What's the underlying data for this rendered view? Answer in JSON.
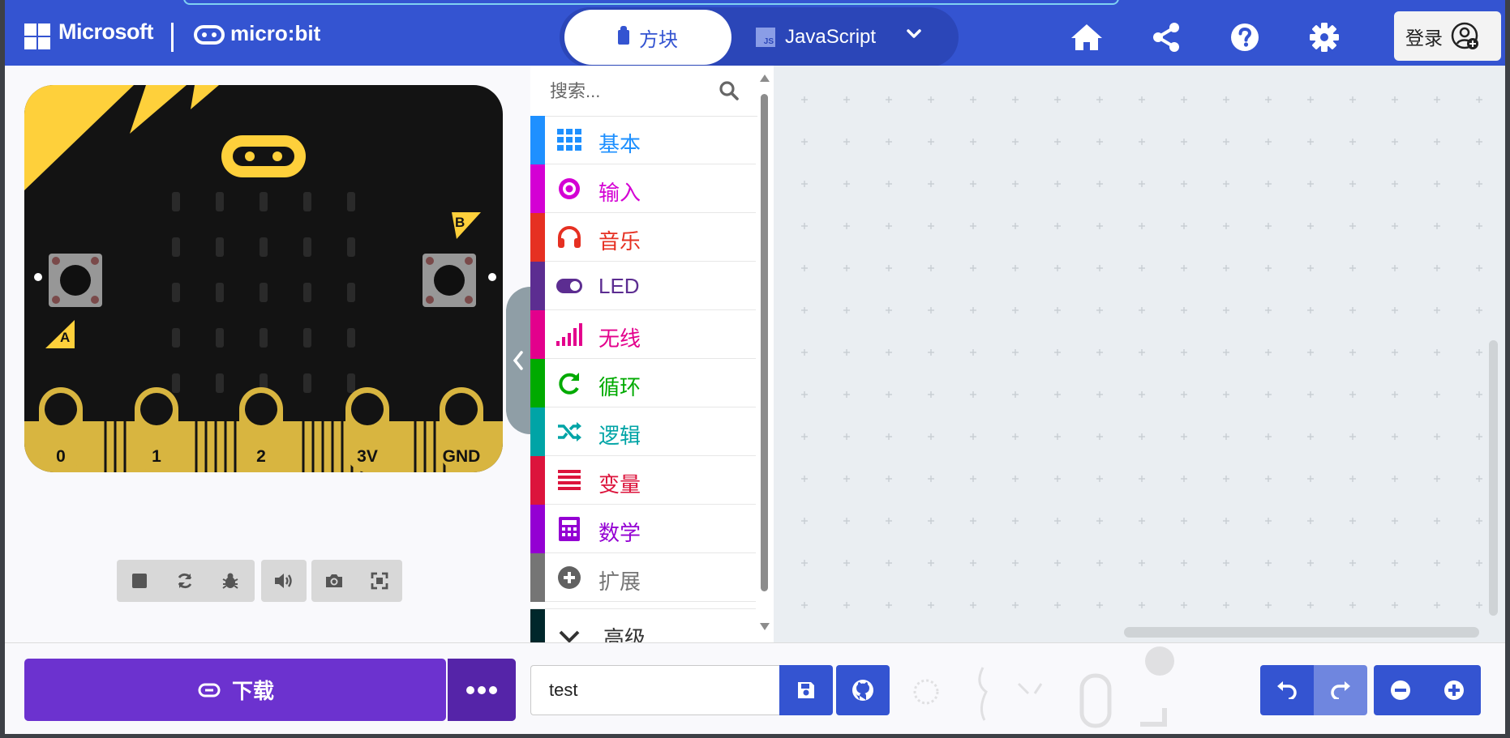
{
  "header": {
    "brand": "Microsoft",
    "product": "micro:bit",
    "tabs": [
      {
        "label": "方块",
        "active": true
      },
      {
        "label": "JavaScript",
        "active": false
      }
    ],
    "js_badge": "JS",
    "login_label": "登录",
    "icons": [
      "home-icon",
      "share-icon",
      "help-icon",
      "settings-icon",
      "user-add-icon"
    ]
  },
  "simulator": {
    "button_a": "A",
    "button_b": "B",
    "pins": [
      "0",
      "1",
      "2",
      "3V",
      "GND"
    ],
    "controls": [
      "stop-icon",
      "restart-icon",
      "debug-icon",
      "sound-icon",
      "screenshot-icon",
      "fullscreen-icon"
    ]
  },
  "toolbox": {
    "search_placeholder": "搜索...",
    "categories": [
      {
        "label": "基本",
        "color": "#1e90ff",
        "icon": "grid-icon"
      },
      {
        "label": "输入",
        "color": "#d400d4",
        "icon": "target-icon"
      },
      {
        "label": "音乐",
        "color": "#e63022",
        "icon": "headphones-icon"
      },
      {
        "label": "LED",
        "color": "#5c2d91",
        "icon": "toggle-icon"
      },
      {
        "label": "无线",
        "color": "#e3008c",
        "icon": "signal-icon"
      },
      {
        "label": "循环",
        "color": "#00aa00",
        "icon": "refresh-icon"
      },
      {
        "label": "逻辑",
        "color": "#00a4a6",
        "icon": "shuffle-icon"
      },
      {
        "label": "变量",
        "color": "#dc143c",
        "icon": "list-icon"
      },
      {
        "label": "数学",
        "color": "#9400d3",
        "icon": "calculator-icon"
      },
      {
        "label": "扩展",
        "color": "#757575",
        "icon": "plus-circle-icon"
      },
      {
        "label": "高级",
        "color": "#00272b",
        "icon": "chevron-down-icon"
      }
    ]
  },
  "footer": {
    "download_label": "下载",
    "project_name": "test"
  }
}
